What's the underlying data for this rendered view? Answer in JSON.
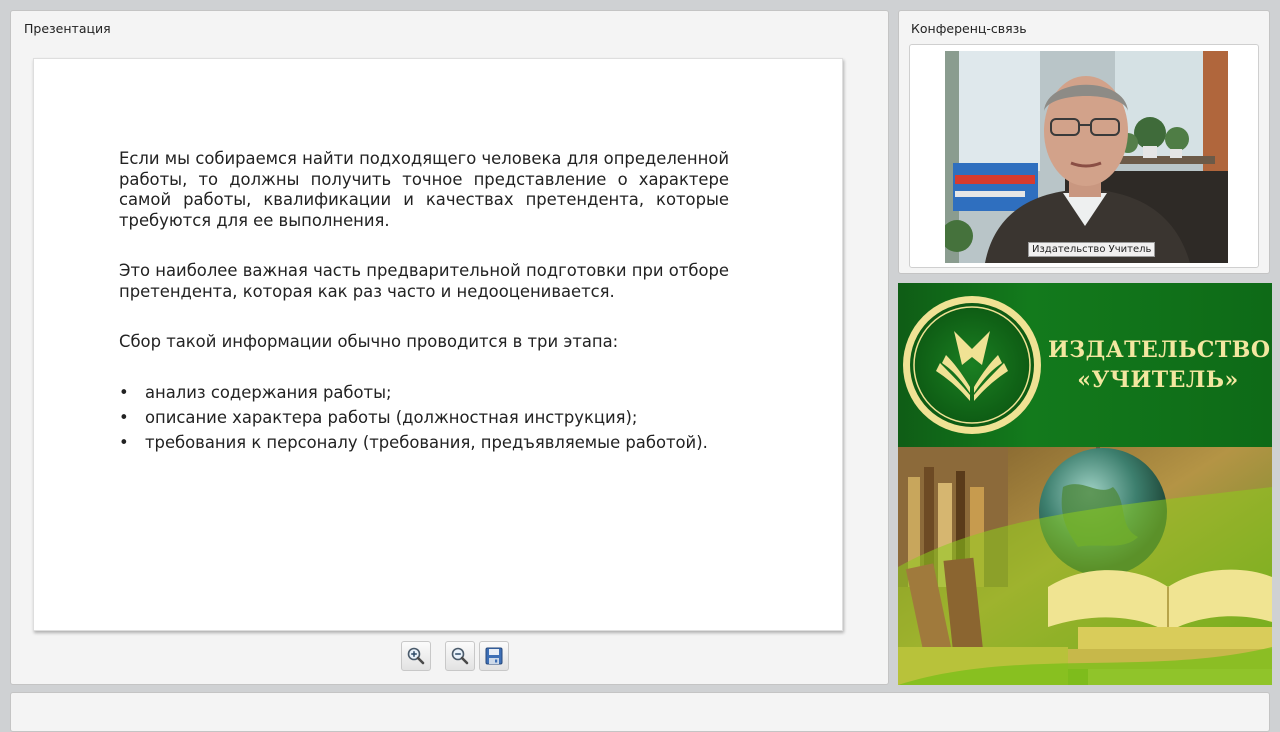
{
  "presentation_panel": {
    "title": "Презентация",
    "slide": {
      "paragraph_1": "Если мы собираемся найти подходящего человека для определенной работы, то должны получить точное представление о характере самой работы, квалификации и качествах претендента, которые требуются для ее выполнения.",
      "paragraph_2": "Это наиболее важная часть предварительной подготовки при отборе претендента, которая как раз часто и недооценивается.",
      "paragraph_3": "Сбор такой информации обычно проводится в три этапа:",
      "bullet_char": "•",
      "bullets": [
        "анализ содержания работы;",
        "описание характера работы (должностная инструкция);",
        "требования к персоналу (требования, предъявляемые работой)."
      ]
    },
    "toolbar": {
      "zoom_in_icon": "zoom-in-icon",
      "zoom_out_icon": "zoom-out-icon",
      "save_icon": "floppy-disk-icon"
    }
  },
  "conference_panel": {
    "title": "Конференц-связь",
    "video_label": "Издательство Учитель"
  },
  "banner": {
    "name_line_1": "ИЗДАТЕЛЬСТВО",
    "name_line_2": "«УЧИТЕЛЬ»",
    "colors": {
      "dark_green": "#0f5d16",
      "gold_text": "#f3e7a0",
      "lime": "#8ccc1c"
    }
  }
}
